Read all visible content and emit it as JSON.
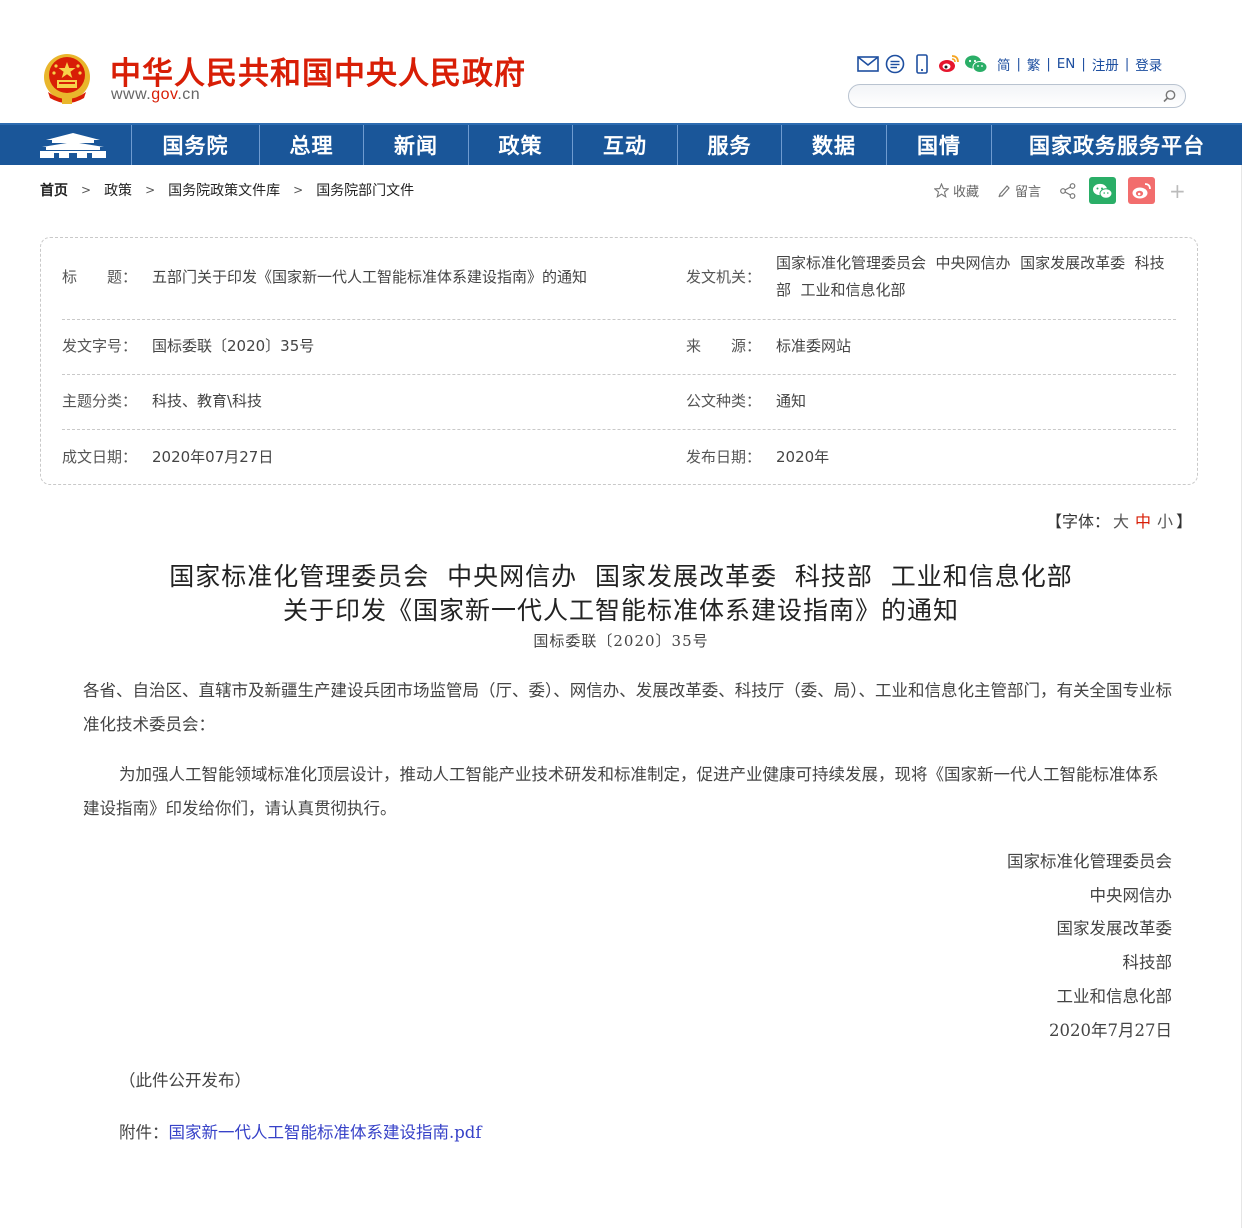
{
  "header": {
    "site_title": "中华人民共和国中央人民政府",
    "site_url_prefix": "www.",
    "site_url_gov": "gov",
    "site_url_suffix": ".cn",
    "links": [
      "简",
      "繁",
      "EN",
      "注册",
      "登录"
    ],
    "search_placeholder": ""
  },
  "nav": {
    "items": [
      "国务院",
      "总理",
      "新闻",
      "政策",
      "互动",
      "服务",
      "数据",
      "国情",
      "国家政务服务平台"
    ]
  },
  "breadcrumb": [
    "首页",
    "政策",
    "国务院政策文件库",
    "国务院部门文件"
  ],
  "tools": {
    "favorite": "收藏",
    "comment": "留言",
    "plus": "+"
  },
  "meta": {
    "title_label": "标　　题：",
    "title_value": "五部门关于印发《国家新一代人工智能标准体系建设指南》的通知",
    "issuer_label": "发文机关：",
    "issuer_value": "国家标准化管理委员会  中央网信办  国家发展改革委  科技部  工业和信息化部",
    "docno_label": "发文字号：",
    "docno_value": "国标委联〔2020〕35号",
    "source_label": "来　　源：",
    "source_value": "标准委网站",
    "topic_label": "主题分类：",
    "topic_value": "科技、教育\\科技",
    "type_label": "公文种类：",
    "type_value": "通知",
    "written_label": "成文日期：",
    "written_value": "2020年07月27日",
    "published_label": "发布日期：",
    "published_value": "2020年"
  },
  "fontsize": {
    "prefix": "【字体：",
    "big": "大",
    "mid": "中",
    "small": "小",
    "suffix": "】"
  },
  "article": {
    "title_line1": "国家标准化管理委员会  中央网信办  国家发展改革委  科技部  工业和信息化部",
    "title_line2": "关于印发《国家新一代人工智能标准体系建设指南》的通知",
    "doc_number": "国标委联〔2020〕35号",
    "salutation": "各省、自治区、直辖市及新疆生产建设兵团市场监管局（厅、委）、网信办、发展改革委、科技厅（委、局）、工业和信息化主管部门，有关全国专业标准化技术委员会：",
    "body": "为加强人工智能领域标准化顶层设计，推动人工智能产业技术研发和标准制定，促进产业健康可持续发展，现将《国家新一代人工智能标准体系建设指南》印发给你们，请认真贯彻执行。",
    "signatures": [
      "国家标准化管理委员会",
      "中央网信办",
      "国家发展改革委",
      "科技部",
      "工业和信息化部",
      "2020年7月27日"
    ],
    "note": "（此件公开发布）",
    "attachment_label": "附件：",
    "attachment_link": "国家新一代人工智能标准体系建设指南.pdf"
  }
}
